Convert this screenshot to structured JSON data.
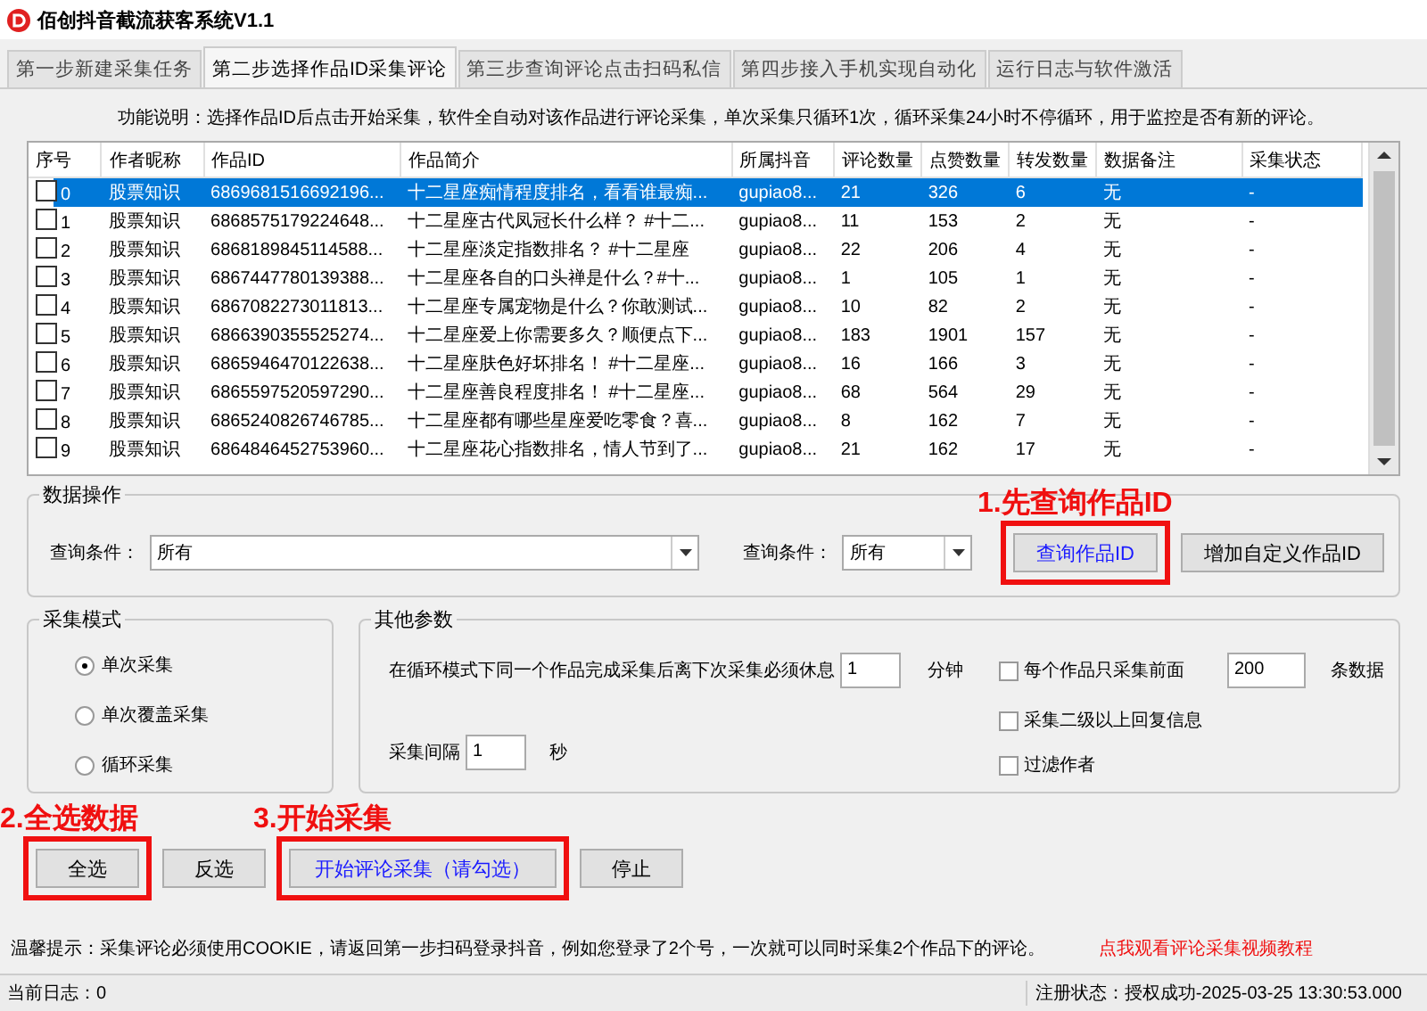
{
  "window": {
    "title": "佰创抖音截流获客系统V1.1"
  },
  "tabs": [
    {
      "label": "第一步新建采集任务",
      "selected": false
    },
    {
      "label": "第二步选择作品ID采集评论",
      "selected": true
    },
    {
      "label": "第三步查询评论点击扫码私信",
      "selected": false
    },
    {
      "label": "第四步接入手机实现自动化",
      "selected": false
    },
    {
      "label": "运行日志与软件激活",
      "selected": false
    }
  ],
  "description": "功能说明：选择作品ID后点击开始采集，软件全自动对该作品进行评论采集，单次采集只循环1次，循环采集24小时不停循环，用于监控是否有新的评论。",
  "table": {
    "columns": [
      "序号",
      "作者昵称",
      "作品ID",
      "作品简介",
      "所属抖音",
      "评论数量",
      "点赞数量",
      "转发数量",
      "数据备注",
      "采集状态"
    ],
    "rows": [
      {
        "checked": false,
        "selected": true,
        "cells": [
          "0",
          "股票知识",
          "6869681516692196...",
          "十二星座痴情程度排名，看看谁最痴...",
          "gupiao8...",
          "21",
          "326",
          "6",
          "无",
          "-"
        ]
      },
      {
        "checked": false,
        "selected": false,
        "cells": [
          "1",
          "股票知识",
          "6868575179224648...",
          "十二星座古代凤冠长什么样？ #十二...",
          "gupiao8...",
          "11",
          "153",
          "2",
          "无",
          "-"
        ]
      },
      {
        "checked": false,
        "selected": false,
        "cells": [
          "2",
          "股票知识",
          "6868189845114588...",
          "十二星座淡定指数排名？ #十二星座",
          "gupiao8...",
          "22",
          "206",
          "4",
          "无",
          "-"
        ]
      },
      {
        "checked": false,
        "selected": false,
        "cells": [
          "3",
          "股票知识",
          "6867447780139388...",
          "十二星座各自的口头禅是什么？#十...",
          "gupiao8...",
          "1",
          "105",
          "1",
          "无",
          "-"
        ]
      },
      {
        "checked": false,
        "selected": false,
        "cells": [
          "4",
          "股票知识",
          "6867082273011813...",
          "十二星座专属宠物是什么？你敢测试...",
          "gupiao8...",
          "10",
          "82",
          "2",
          "无",
          "-"
        ]
      },
      {
        "checked": false,
        "selected": false,
        "cells": [
          "5",
          "股票知识",
          "6866390355525274...",
          "十二星座爱上你需要多久？顺便点下...",
          "gupiao8...",
          "183",
          "1901",
          "157",
          "无",
          "-"
        ]
      },
      {
        "checked": false,
        "selected": false,
        "cells": [
          "6",
          "股票知识",
          "6865946470122638...",
          "十二星座肤色好坏排名！ #十二星座...",
          "gupiao8...",
          "16",
          "166",
          "3",
          "无",
          "-"
        ]
      },
      {
        "checked": false,
        "selected": false,
        "cells": [
          "7",
          "股票知识",
          "6865597520597290...",
          "十二星座善良程度排名！ #十二星座...",
          "gupiao8...",
          "68",
          "564",
          "29",
          "无",
          "-"
        ]
      },
      {
        "checked": false,
        "selected": false,
        "cells": [
          "8",
          "股票知识",
          "6865240826746785...",
          "十二星座都有哪些星座爱吃零食？喜...",
          "gupiao8...",
          "8",
          "162",
          "7",
          "无",
          "-"
        ]
      },
      {
        "checked": false,
        "selected": false,
        "cells": [
          "9",
          "股票知识",
          "6864846452753960...",
          "十二星座花心指数排名，情人节到了...",
          "gupiao8...",
          "21",
          "162",
          "17",
          "无",
          "-"
        ]
      }
    ]
  },
  "data_ops": {
    "title": "数据操作",
    "filters": [
      {
        "label": "查询条件：",
        "value": "所有"
      },
      {
        "label": "查询条件：",
        "value": "所有"
      }
    ],
    "buttons": [
      {
        "label": "查询作品ID",
        "primary": true,
        "highlighted": true,
        "annotation": "1.先查询作品ID"
      },
      {
        "label": "增加自定义作品ID",
        "primary": false,
        "highlighted": false
      }
    ]
  },
  "mode": {
    "title": "采集模式",
    "options": [
      {
        "label": "单次采集",
        "selected": true
      },
      {
        "label": "单次覆盖采集",
        "selected": false
      },
      {
        "label": "循环采集",
        "selected": false
      }
    ]
  },
  "params": {
    "title": "其他参数",
    "rest": {
      "label": "在循环模式下同一个作品完成采集后离下次采集必须休息",
      "value": "1",
      "unit": "分钟"
    },
    "interval": {
      "label": "采集间隔",
      "value": "1",
      "unit": "秒"
    },
    "options": [
      {
        "label": "每个作品只采集前面",
        "checked": false,
        "value": "200",
        "unit": "条数据"
      },
      {
        "label": "采集二级以上回复信息",
        "checked": false
      },
      {
        "label": "过滤作者",
        "checked": false
      }
    ]
  },
  "actions": [
    {
      "label": "全选",
      "primary": false,
      "highlighted": true,
      "annotation": "2.全选数据"
    },
    {
      "label": "反选",
      "primary": false,
      "highlighted": false
    },
    {
      "label": "开始评论采集（请勾选）",
      "primary": true,
      "highlighted": true,
      "annotation": "3.开始采集"
    },
    {
      "label": "停止",
      "primary": false,
      "highlighted": false
    }
  ],
  "tip": "温馨提示：采集评论必须使用COOKIE，请返回第一步扫码登录抖音，例如您登录了2个号，一次就可以同时采集2个作品下的评论。",
  "tutorial_link": "点我观看评论采集视频教程",
  "status_bar": {
    "log": "当前日志：0",
    "registration": "注册状态：授权成功-2025-03-25 13:30:53.000"
  }
}
